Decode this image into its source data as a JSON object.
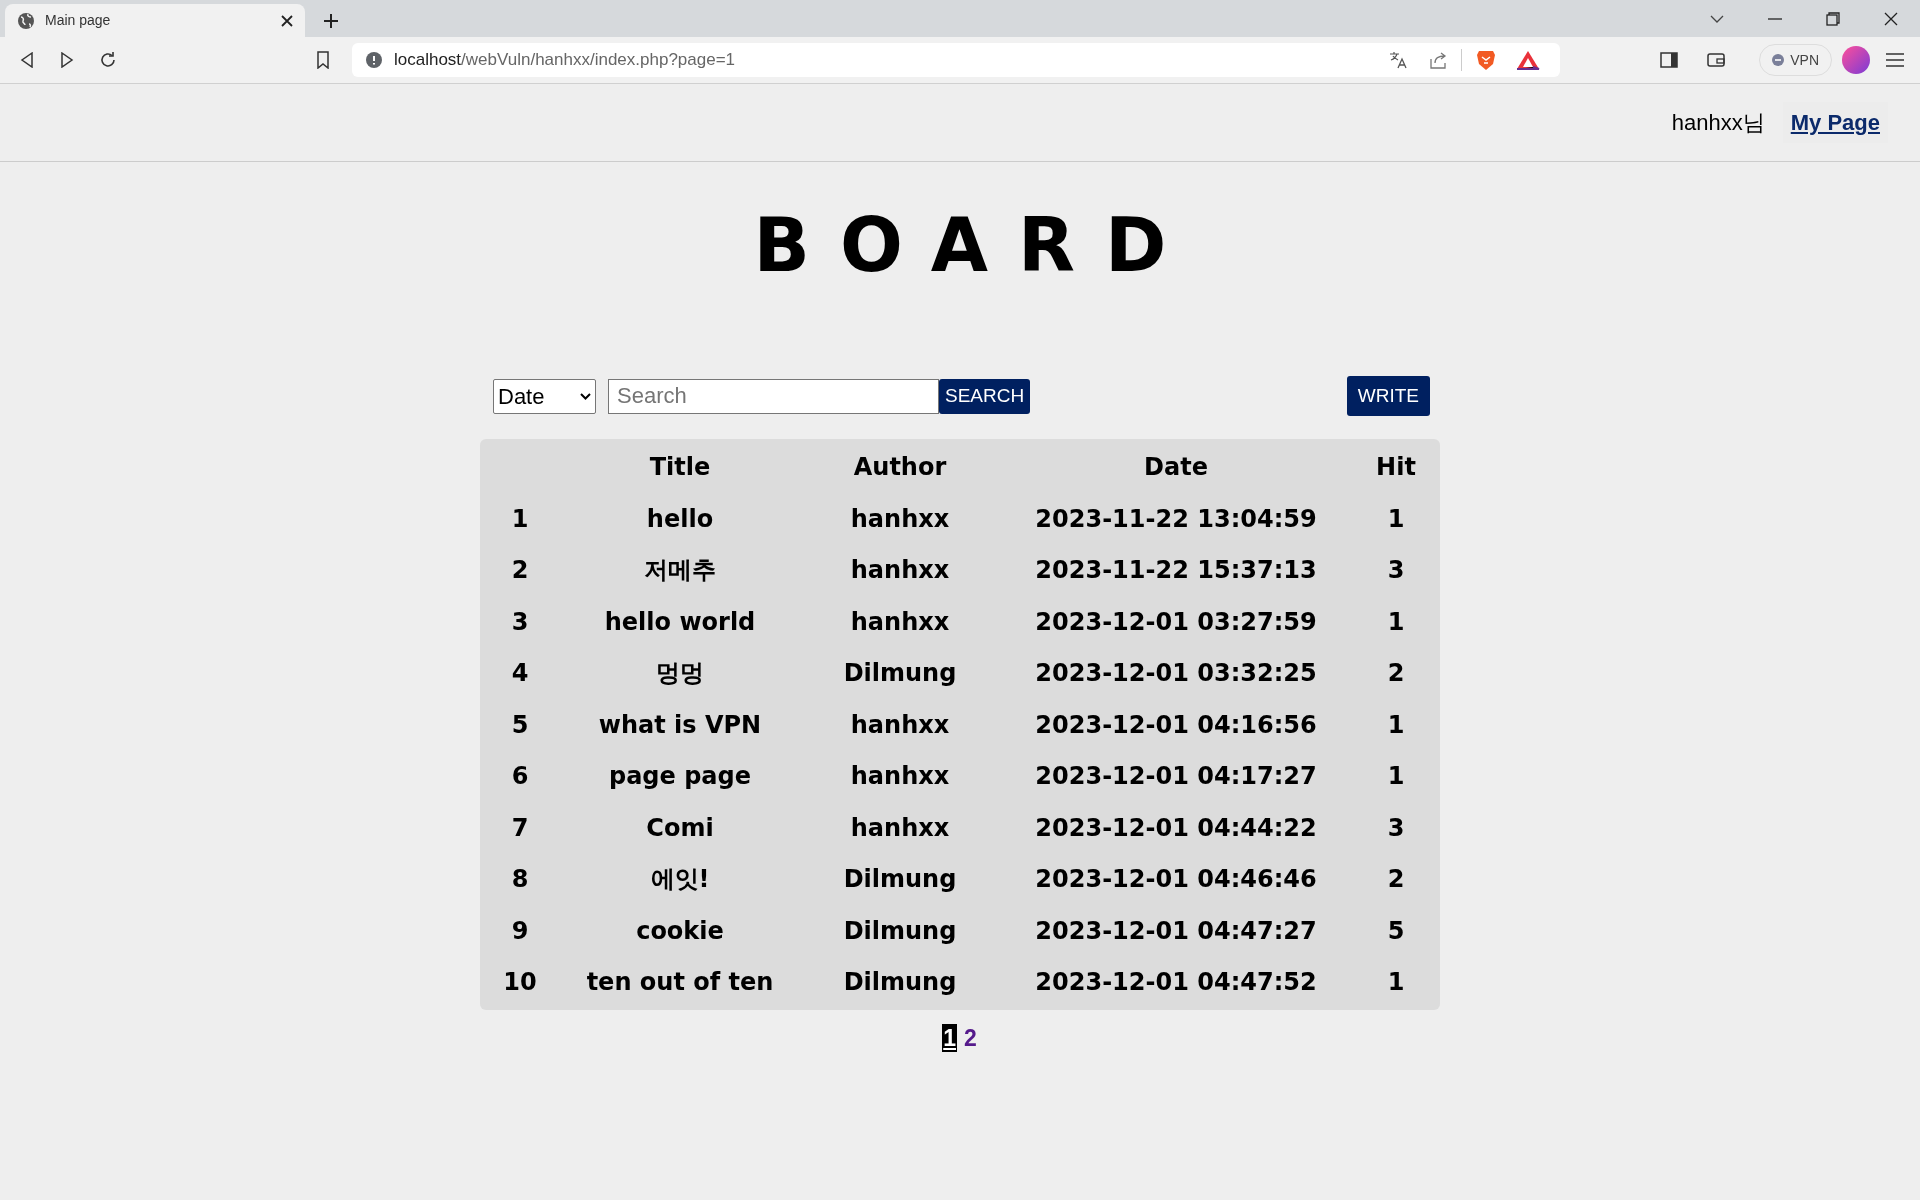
{
  "browser": {
    "tab": {
      "title": "Main page"
    },
    "url_host": "localhost",
    "url_path": "/webVuln/hanhxx/index.php?page=1",
    "vpn_label": "VPN"
  },
  "header": {
    "greeting": "hanhxx님",
    "my_page_link": "My Page"
  },
  "title": "BOARD",
  "toolbar": {
    "filter": "Date",
    "search": {
      "placeholder": "Search"
    },
    "search_button": "SEARCH",
    "write_button": "WRITE"
  },
  "table": {
    "columns": [
      "",
      "Title",
      "Author",
      "Date",
      "Hit"
    ],
    "rows": [
      [
        "1",
        "hello",
        "hanhxx",
        "2023-11-22 13:04:59",
        "1"
      ],
      [
        "2",
        "저메추",
        "hanhxx",
        "2023-11-22 15:37:13",
        "3"
      ],
      [
        "3",
        "hello world",
        "hanhxx",
        "2023-12-01 03:27:59",
        "1"
      ],
      [
        "4",
        "멍멍",
        "Dilmung",
        "2023-12-01 03:32:25",
        "2"
      ],
      [
        "5",
        "what is VPN",
        "hanhxx",
        "2023-12-01 04:16:56",
        "1"
      ],
      [
        "6",
        "page page",
        "hanhxx",
        "2023-12-01 04:17:27",
        "1"
      ],
      [
        "7",
        "Comi",
        "hanhxx",
        "2023-12-01 04:44:22",
        "3"
      ],
      [
        "8",
        "에잇!",
        "Dilmung",
        "2023-12-01 04:46:46",
        "2"
      ],
      [
        "9",
        "cookie",
        "Dilmung",
        "2023-12-01 04:47:27",
        "5"
      ],
      [
        "10",
        "ten out of ten",
        "Dilmung",
        "2023-12-01 04:47:52",
        "1"
      ]
    ]
  },
  "pagination": [
    {
      "label": "1",
      "selected": true
    },
    {
      "label": "2",
      "selected": false
    }
  ]
}
